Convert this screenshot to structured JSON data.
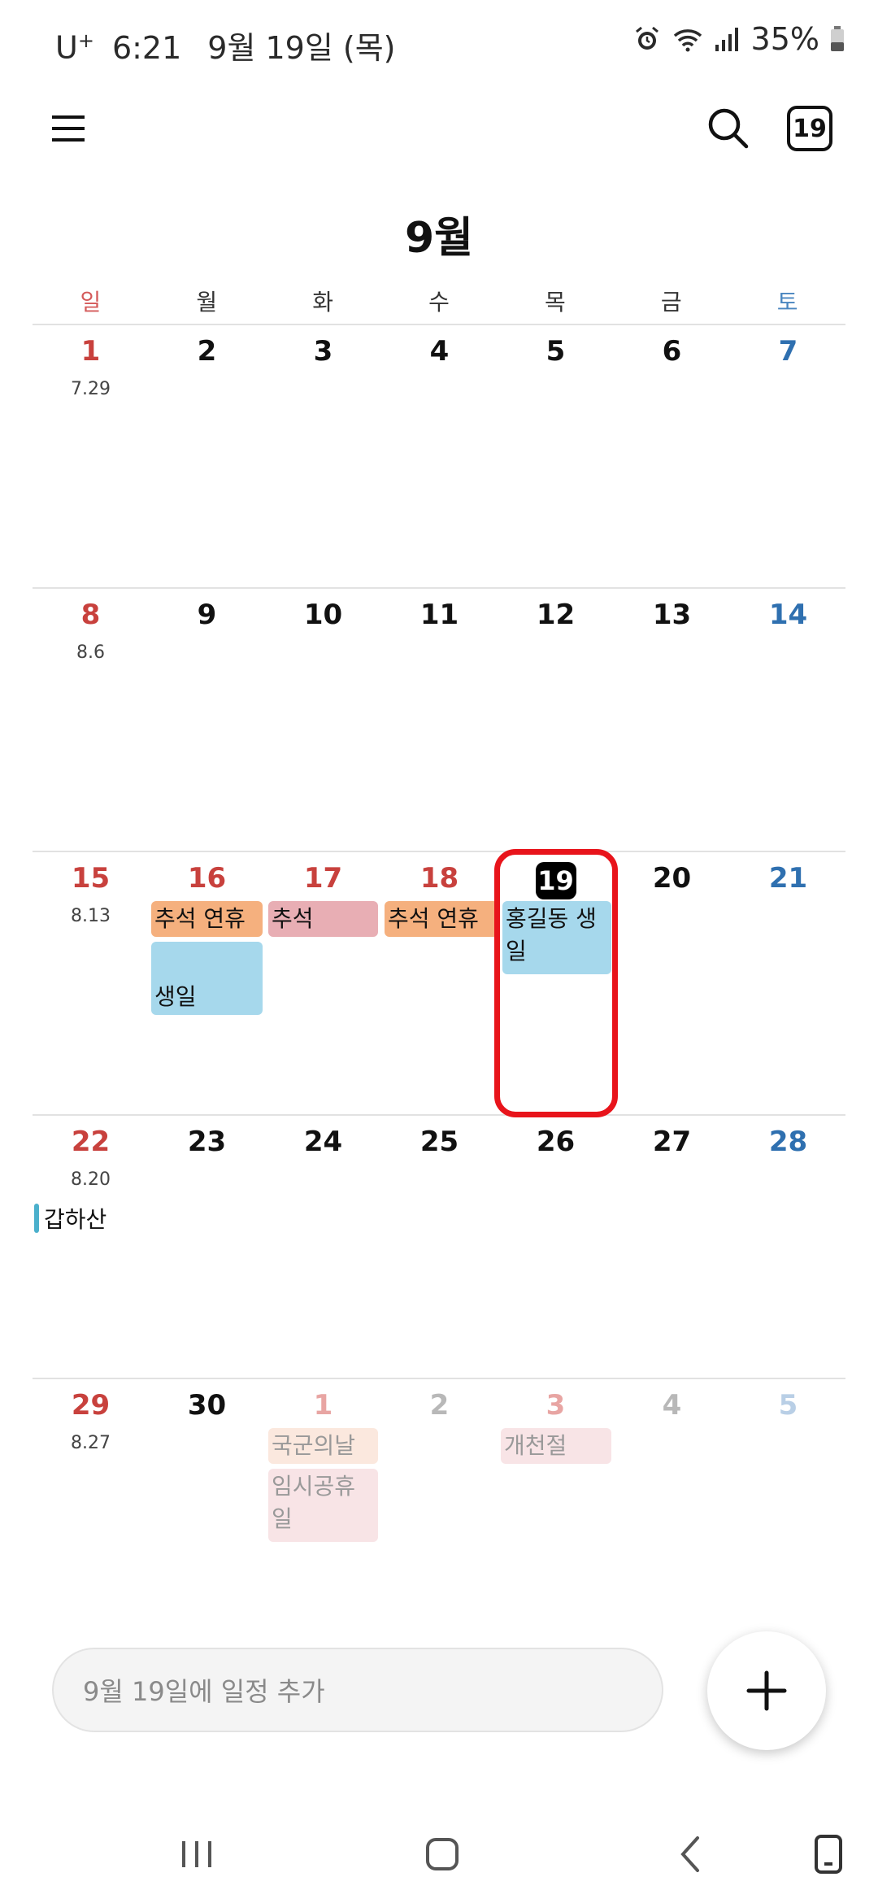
{
  "status_bar": {
    "carrier": "U",
    "carrier_sup": "+",
    "time": "6:21",
    "date": "9월 19일 (목)",
    "battery": "35%"
  },
  "top_bar": {
    "today_label": "19"
  },
  "month_title": "9월",
  "weekdays": [
    "일",
    "월",
    "화",
    "수",
    "목",
    "금",
    "토"
  ],
  "weeks": [
    {
      "days": [
        "1",
        "2",
        "3",
        "4",
        "5",
        "6",
        "7"
      ],
      "lunar": "7.29"
    },
    {
      "days": [
        "8",
        "9",
        "10",
        "11",
        "12",
        "13",
        "14"
      ],
      "lunar": "8.6"
    },
    {
      "days": [
        "15",
        "16",
        "17",
        "18",
        "19",
        "20",
        "21"
      ],
      "lunar": "8.13"
    },
    {
      "days": [
        "22",
        "23",
        "24",
        "25",
        "26",
        "27",
        "28"
      ],
      "lunar": "8.20"
    },
    {
      "days": [
        "29",
        "30",
        "1",
        "2",
        "3",
        "4",
        "5"
      ],
      "lunar": "8.27"
    }
  ],
  "events": {
    "chuseok_holiday_16": "추석 연휴",
    "chuseok_17": "추석",
    "chuseok_holiday_18": "추석 연휴",
    "birthday_16": "생일",
    "hong_birthday_19": "홍길동 생일",
    "gapha_22": "갑하산",
    "armed_forces_day": "국군의날",
    "temp_holiday": "임시공휴일",
    "foundation_day": "개천절"
  },
  "quick_add": {
    "placeholder": "9월 19일에 일정 추가"
  },
  "colors": {
    "sunday": "#c8413d",
    "saturday": "#2f70b0",
    "event_orange": "#f5b07e",
    "event_pink": "#e8aeb4",
    "event_blue": "#a6d8ec",
    "highlight": "#e8141b"
  },
  "icons": [
    "alarm-icon",
    "wifi-icon",
    "signal-icon",
    "battery-icon",
    "menu-icon",
    "search-icon",
    "plus-icon",
    "recent-apps-icon",
    "home-icon",
    "back-icon",
    "keyboard-icon"
  ]
}
